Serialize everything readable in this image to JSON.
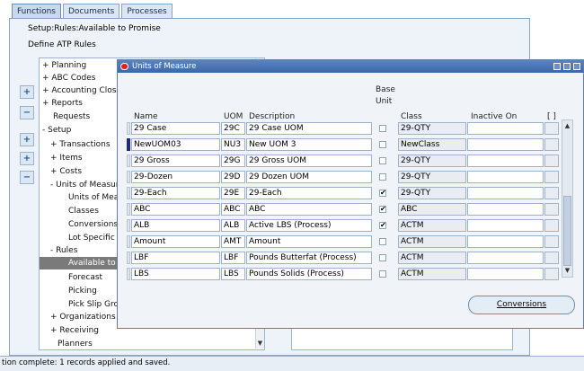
{
  "tabs": [
    "Functions",
    "Documents",
    "Processes"
  ],
  "nav": {
    "breadcrumb": "Setup:Rules:Available to Promise",
    "heading": "Define ATP Rules",
    "tree": [
      "+  Planning",
      "+  ABC Codes",
      "+  Accounting Close",
      "+  Reports",
      "Requests",
      "-  Setup",
      "+  Transactions",
      "+  Items",
      "+  Costs",
      "-  Units of Measure",
      "Units of Meas",
      "Classes",
      "Conversions",
      "Lot Specific C",
      "-  Rules",
      "Available to P",
      "Forecast",
      "Picking",
      "Pick Slip Gro",
      "+  Organizations",
      "+  Receiving",
      "Planners"
    ],
    "buttons": [
      "+",
      "−",
      "+",
      "+",
      "−"
    ]
  },
  "dialog": {
    "title": "Units of Measure",
    "headers": {
      "name": "Name",
      "uom": "UOM",
      "desc": "Description",
      "base1": "Base",
      "base2": "Unit",
      "class": "Class",
      "inactive": "Inactive On",
      "flex": "[ ]"
    },
    "rows": [
      {
        "name": "29 Case",
        "uom": "29C",
        "desc": "29 Case UOM",
        "base": false,
        "cls": "29-QTY"
      },
      {
        "name": "NewUOM03",
        "uom": "NU3",
        "desc": "New UOM 3",
        "base": false,
        "cls": "NewClass"
      },
      {
        "name": "29 Gross",
        "uom": "29G",
        "desc": "29 Gross UOM",
        "base": false,
        "cls": "29-QTY"
      },
      {
        "name": "29-Dozen",
        "uom": "29D",
        "desc": "29 Dozen UOM",
        "base": false,
        "cls": "29-QTY"
      },
      {
        "name": "29-Each",
        "uom": "29E",
        "desc": "29-Each",
        "base": true,
        "cls": "29-QTY"
      },
      {
        "name": "ABC",
        "uom": "ABC",
        "desc": "ABC",
        "base": true,
        "cls": "ABC"
      },
      {
        "name": "ALB",
        "uom": "ALB",
        "desc": "Active LBS (Process)",
        "base": true,
        "cls": "ACTM"
      },
      {
        "name": "Amount",
        "uom": "AMT",
        "desc": "Amount",
        "base": false,
        "cls": "ACTM"
      },
      {
        "name": "LBF",
        "uom": "LBF",
        "desc": "Pounds Butterfat (Process)",
        "base": false,
        "cls": "ACTM"
      },
      {
        "name": "LBS",
        "uom": "LBS",
        "desc": "Pounds Solids (Process)",
        "base": false,
        "cls": "ACTM"
      }
    ],
    "conversions_label": "Conversions"
  },
  "status": {
    "text": "tion complete: 1 records applied and saved."
  }
}
